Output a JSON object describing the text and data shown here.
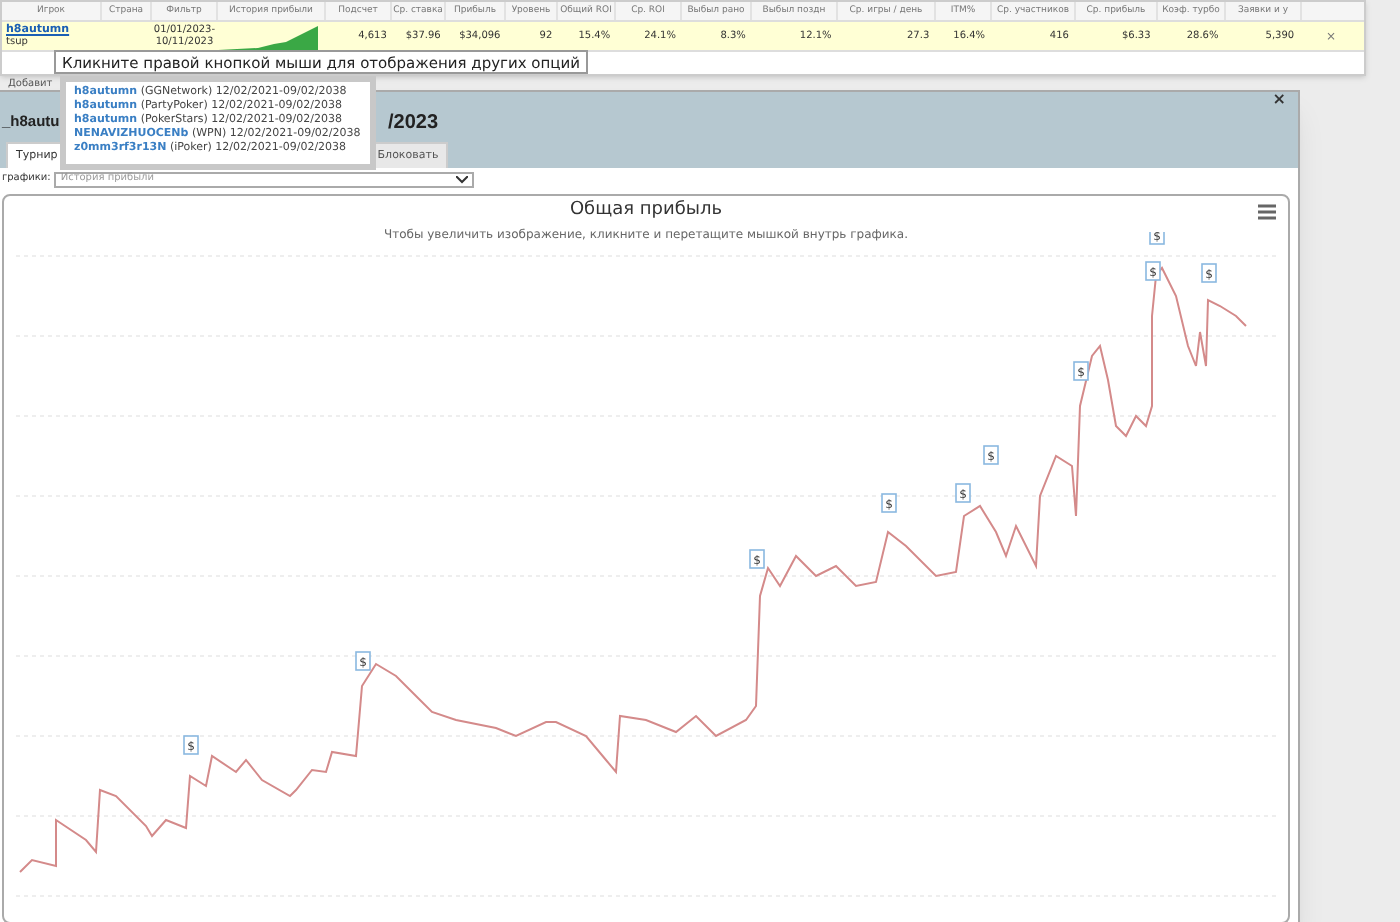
{
  "table": {
    "columns": [
      "Игрок",
      "Страна",
      "Фильтр",
      "История прибыли",
      "Подсчет",
      "Ср. ставка",
      "Прибыль",
      "Уровень",
      "Общий ROI",
      "Ср. ROI",
      "Выбыл рано",
      "Выбыл поздн",
      "Ср. игры / день",
      "ITM%",
      "Ср. участников",
      "Ср. прибыль",
      "Коэф. турбо",
      "Заявки и у"
    ],
    "rows": [
      {
        "player_note": "tsup",
        "cells": [
          "h8autumn",
          "",
          "01/01/2023-10/11/2023",
          "",
          "4,613",
          "$37.96",
          "$34,096",
          "92",
          "15.4%",
          "24.1%",
          "8.3%",
          "12.1%",
          "27.3",
          "16.4%",
          "416",
          "$6.33",
          "28.6%",
          "5,390"
        ],
        "remove": "×"
      }
    ]
  },
  "add_link": "Добавит",
  "tooltip": "Кликните правой кнопкой мыши для отображения других опций",
  "accounts": [
    {
      "name": "h8autumn",
      "network": "(GGNetwork)",
      "dates": "12/02/2021-09/02/2038"
    },
    {
      "name": "h8autumn",
      "network": "(PartyPoker)",
      "dates": "12/02/2021-09/02/2038"
    },
    {
      "name": "h8autumn",
      "network": "(PokerStars)",
      "dates": "12/02/2021-09/02/2038"
    },
    {
      "name": "NENAVIZHUOCENb",
      "network": "(WPN)",
      "dates": "12/02/2021-09/02/2038"
    },
    {
      "name": "z0mm3rf3r13N",
      "network": "(iPoker)",
      "dates": "12/02/2021-09/02/2038"
    }
  ],
  "dialog": {
    "title_left": "_h8autu",
    "title_right": "/2023",
    "close": "×",
    "tabs": [
      {
        "label": "Турнир",
        "selected": true
      },
      {
        "label": "Блоковать",
        "selected": false
      }
    ],
    "chart_selector": {
      "label": "графики:",
      "value": "История прибыли"
    },
    "chart": {
      "title": "Общая прибыль",
      "subtitle": "Чтобы увеличить изображение, кликните и перетащите мышкой внутрь графика.",
      "flags": [
        "$",
        "$",
        "$",
        "$",
        "$",
        "$",
        "$",
        "$",
        "$",
        "$"
      ]
    }
  }
}
